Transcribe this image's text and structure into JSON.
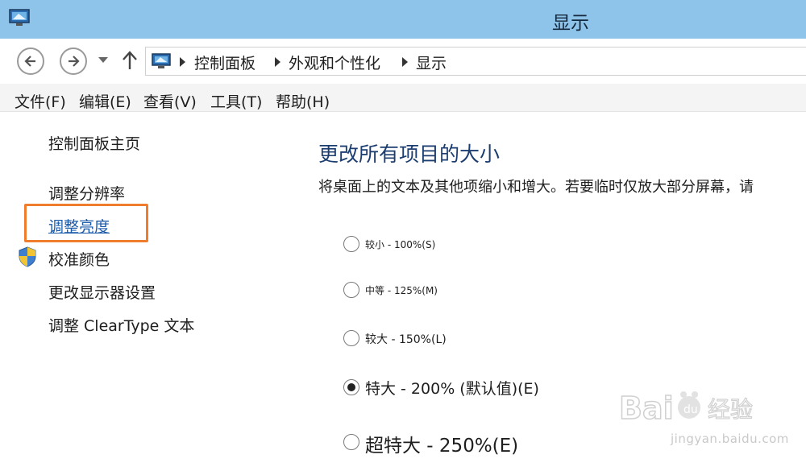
{
  "window": {
    "title": "显示"
  },
  "address": {
    "breadcrumbs": [
      "控制面板",
      "外观和个性化",
      "显示"
    ]
  },
  "menu": {
    "items": [
      "文件(F)",
      "编辑(E)",
      "查看(V)",
      "工具(T)",
      "帮助(H)"
    ]
  },
  "sidebar": {
    "items": [
      {
        "label": "控制面板主页"
      },
      {
        "label": "调整分辨率"
      },
      {
        "label": "调整亮度",
        "active": true
      },
      {
        "label": "校准颜色",
        "icon": "shield-icon"
      },
      {
        "label": "更改显示器设置"
      },
      {
        "label": "调整 ClearType 文本"
      }
    ]
  },
  "main": {
    "heading": "更改所有项目的大小",
    "description": "将桌面上的文本及其他项缩小和增大。若要临时仅放大部分屏幕，请",
    "options": [
      {
        "label": "较小 - 100%(S)",
        "checked": false
      },
      {
        "label": "中等 - 125%(M)",
        "checked": false
      },
      {
        "label": "较大 - 150%(L)",
        "checked": false
      },
      {
        "label": "特大 - 200% (默认值)(E)",
        "checked": true
      },
      {
        "label": "超特大 - 250%(E)",
        "checked": false
      }
    ]
  },
  "watermark": {
    "brand": "Bai 经验",
    "url": "jingyan.baidu.com"
  },
  "colors": {
    "titlebar": "#8ec3ea",
    "highlight": "#ef7d2d",
    "link": "#1a5aa8",
    "heading": "#1c3d70"
  }
}
